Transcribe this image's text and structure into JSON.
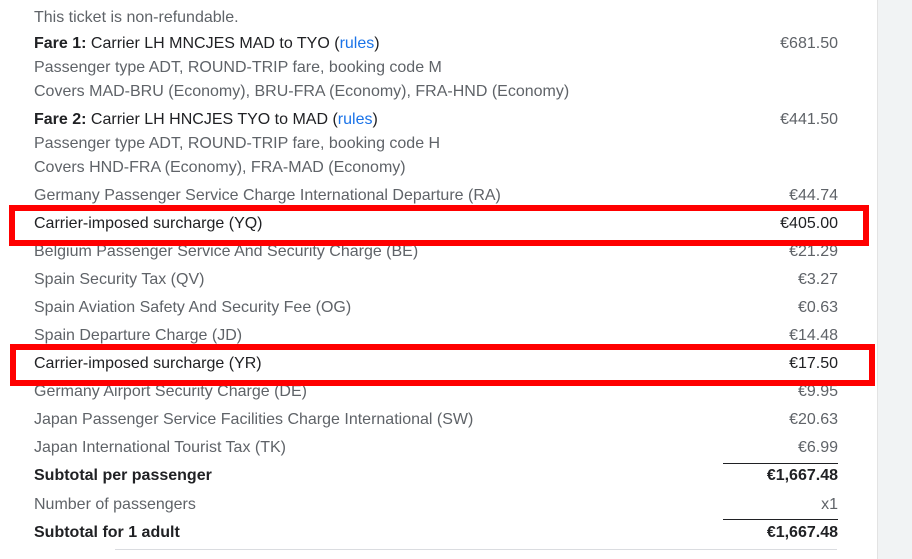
{
  "notice": "This ticket is non-refundable.",
  "fares": [
    {
      "label": "Fare 1:",
      "description": "Carrier LH MNCJES MAD to TYO",
      "paren_open": "(",
      "rules_link": "rules",
      "paren_close": ")",
      "price": "€681.50",
      "passenger_line": "Passenger type ADT, ROUND-TRIP fare, booking code M",
      "covers_line": "Covers MAD-BRU (Economy), BRU-FRA (Economy), FRA-HND (Economy)"
    },
    {
      "label": "Fare 2:",
      "description": "Carrier LH HNCJES TYO to MAD",
      "paren_open": "(",
      "rules_link": "rules",
      "paren_close": ")",
      "price": "€441.50",
      "passenger_line": "Passenger type ADT, ROUND-TRIP fare, booking code H",
      "covers_line": "Covers HND-FRA (Economy), FRA-MAD (Economy)"
    }
  ],
  "taxes": [
    {
      "label": "Germany Passenger Service Charge International Departure (RA)",
      "amount": "€44.74",
      "highlighted": false
    },
    {
      "label": "Carrier-imposed surcharge (YQ)",
      "amount": "€405.00",
      "highlighted": true
    },
    {
      "label": "Belgium Passenger Service And Security Charge (BE)",
      "amount": "€21.29",
      "highlighted": false
    },
    {
      "label": "Spain Security Tax (QV)",
      "amount": "€3.27",
      "highlighted": false
    },
    {
      "label": "Spain Aviation Safety And Security Fee (OG)",
      "amount": "€0.63",
      "highlighted": false
    },
    {
      "label": "Spain Departure Charge (JD)",
      "amount": "€14.48",
      "highlighted": false
    },
    {
      "label": "Carrier-imposed surcharge (YR)",
      "amount": "€17.50",
      "highlighted": true
    },
    {
      "label": "Germany Airport Security Charge (DE)",
      "amount": "€9.95",
      "highlighted": false
    },
    {
      "label": "Japan Passenger Service Facilities Charge International (SW)",
      "amount": "€20.63",
      "highlighted": false
    },
    {
      "label": "Japan International Tourist Tax (TK)",
      "amount": "€6.99",
      "highlighted": false
    }
  ],
  "subtotal_per_passenger": {
    "label": "Subtotal per passenger",
    "amount": "€1,667.48"
  },
  "passengers": {
    "label": "Number of passengers",
    "value": "x1"
  },
  "subtotal_total": {
    "label": "Subtotal for 1 adult",
    "amount": "€1,667.48"
  },
  "highlight_color": "#ff0000",
  "link_color": "#1a73e8"
}
